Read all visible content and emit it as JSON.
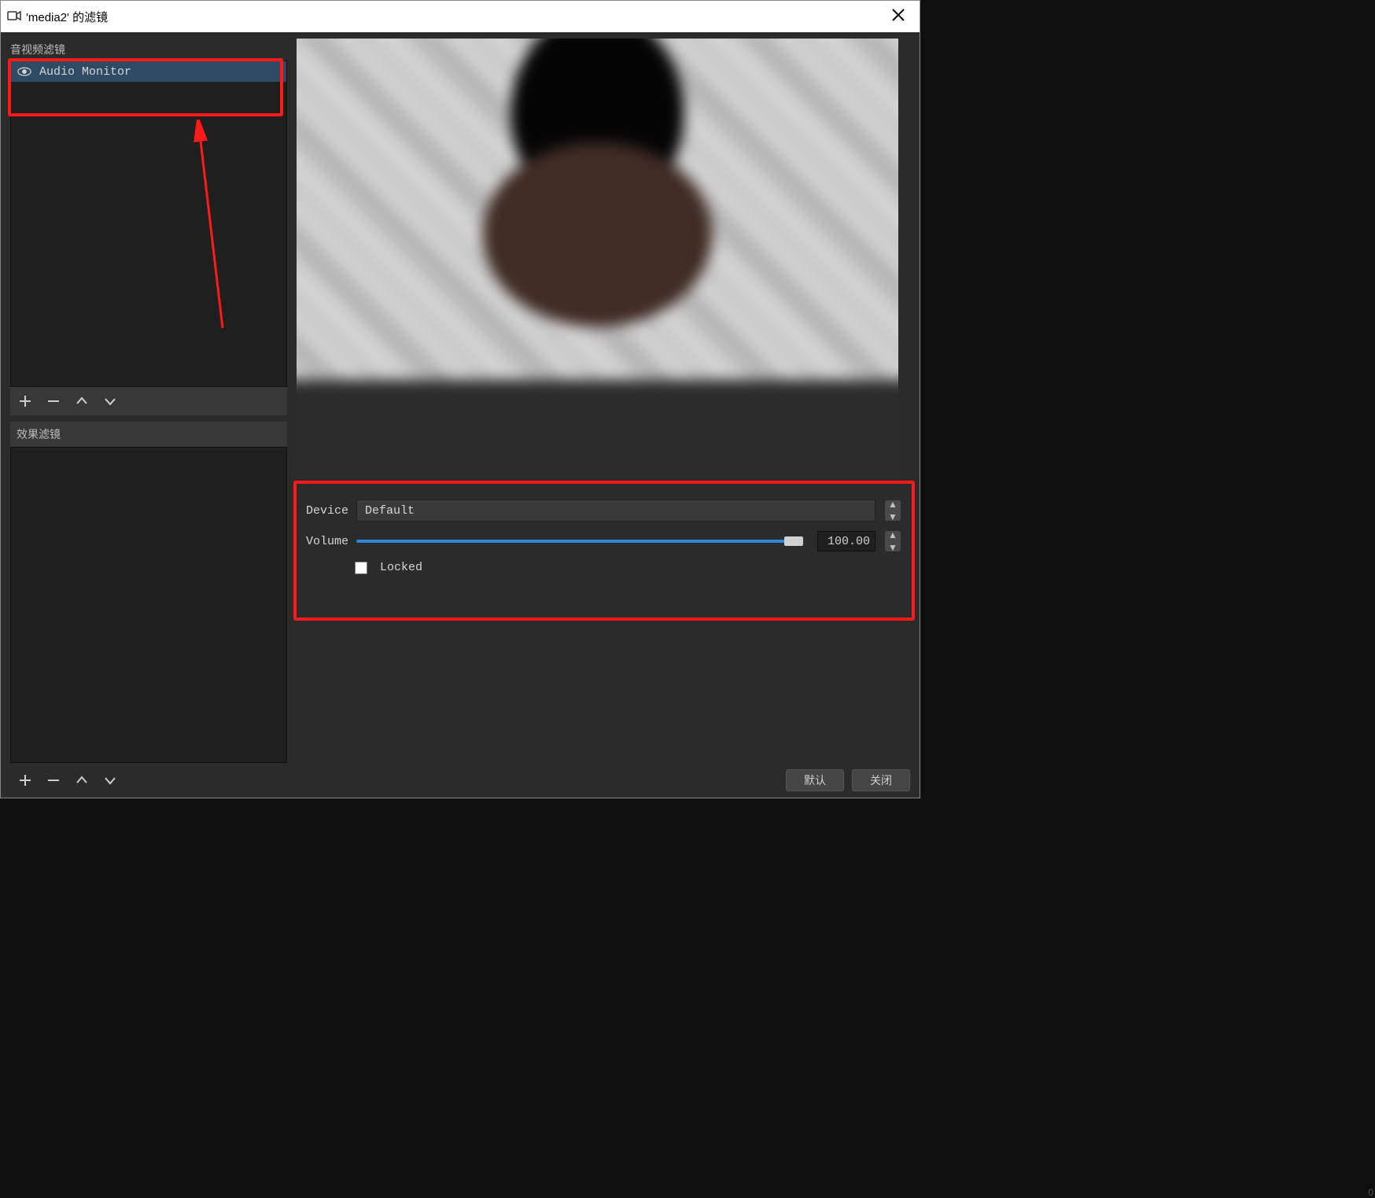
{
  "title_bar": {
    "title": "'media2' 的滤镜"
  },
  "left_panel": {
    "av_filters_label": "音视频滤镜",
    "av_filters": [
      {
        "name": "Audio Monitor",
        "visible": true,
        "selected": true
      }
    ],
    "effect_filters_label": "效果滤镜"
  },
  "properties": {
    "device_label": "Device",
    "device_value": "Default",
    "volume_label": "Volume",
    "volume_value": "100.00",
    "locked_label": "Locked",
    "locked_checked": false
  },
  "footer": {
    "btn_defaults": "默认",
    "btn_close": "关闭"
  }
}
